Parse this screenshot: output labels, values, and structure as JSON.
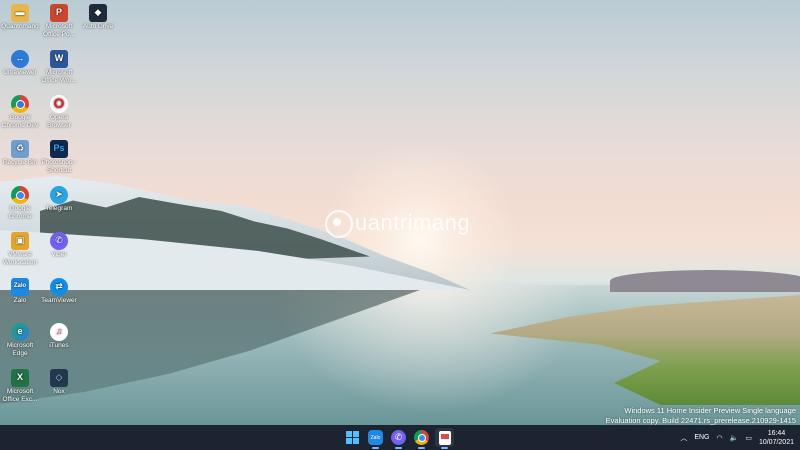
{
  "desktop": {
    "watermark": "uantrimang",
    "build_info": {
      "line1": "Windows 11 Home Insider Preview Single language",
      "line2": "Evaluation copy. Build 22471.rs_prerelease.210929-1415"
    },
    "icons": [
      {
        "label": "Quantrimang",
        "icon": "folder-icon",
        "color": "#e8b64a"
      },
      {
        "label": "Microsoft Office Po...",
        "icon": "powerpoint-icon",
        "color": "#c9472c"
      },
      {
        "label": "Auto Drive",
        "icon": "autodrive-icon",
        "color": "#1f2b3a"
      },
      {
        "label": "UltraViewer",
        "icon": "ultraviewer-icon",
        "color": "#2d7bd8"
      },
      {
        "label": "Microsoft Office Wor...",
        "icon": "word-icon",
        "color": "#2b579a"
      },
      {
        "label": "Google Chrome Dev",
        "icon": "chrome-dev-icon",
        "color": "#3c78d8"
      },
      {
        "label": "Opera Browser",
        "icon": "opera-icon",
        "color": "#e1222a"
      },
      {
        "label": "Recycle Bin",
        "icon": "recycle-bin-icon",
        "color": "#6f9fce"
      },
      {
        "label": "Photoshop - Shortcut",
        "icon": "photoshop-icon",
        "color": "#0f2a4a"
      },
      {
        "label": "Google Chrome",
        "icon": "chrome-icon",
        "color": "#dd4b39"
      },
      {
        "label": "Telegram",
        "icon": "telegram-icon",
        "color": "#2aa3df"
      },
      {
        "label": "VMware Workstation",
        "icon": "vmware-icon",
        "color": "#e3a629"
      },
      {
        "label": "Viber",
        "icon": "viber-icon",
        "color": "#7360f2"
      },
      {
        "label": "Zalo",
        "icon": "zalo-icon",
        "color": "#1e88e5"
      },
      {
        "label": "TeamViewer",
        "icon": "teamviewer-icon",
        "color": "#0e8ee9"
      },
      {
        "label": "Microsoft Edge",
        "icon": "edge-icon",
        "color": "#1fa37c"
      },
      {
        "label": "iTunes",
        "icon": "itunes-icon",
        "color": "#e84c8d"
      },
      {
        "label": "Microsoft Office Exc...",
        "icon": "excel-icon",
        "color": "#217346"
      },
      {
        "label": "Nox",
        "icon": "nox-icon",
        "color": "#23384f"
      }
    ]
  },
  "taskbar": {
    "apps": [
      {
        "name": "start",
        "icon": "windows-start-icon"
      },
      {
        "name": "zalo",
        "icon": "zalo-icon",
        "text": "Zalo"
      },
      {
        "name": "viber",
        "icon": "viber-icon"
      },
      {
        "name": "chrome",
        "icon": "chrome-icon"
      },
      {
        "name": "snipping",
        "icon": "snipping-tool-icon"
      }
    ],
    "tray": {
      "language": "ENG",
      "time": "16:44",
      "date": "10/07/2021"
    }
  }
}
